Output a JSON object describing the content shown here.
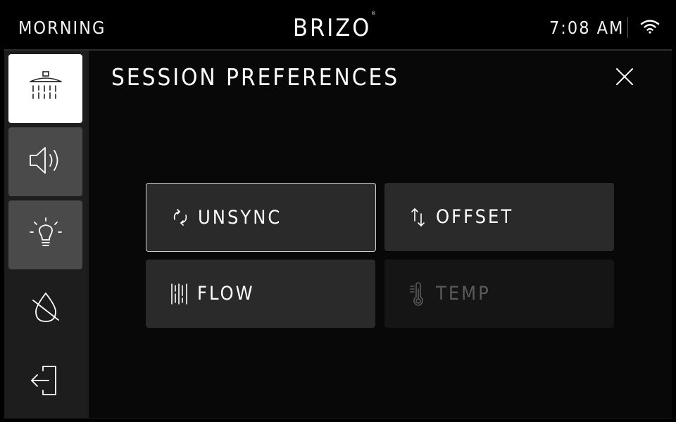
{
  "header": {
    "mode": "MORNING",
    "brand": "BRIZO",
    "time": "7:08 AM"
  },
  "sidebar": {
    "items": [
      {
        "icon": "shower-head-icon",
        "active": true
      },
      {
        "icon": "speaker-icon"
      },
      {
        "icon": "lightbulb-icon"
      },
      {
        "icon": "water-off-icon"
      },
      {
        "icon": "exit-icon"
      }
    ]
  },
  "main": {
    "title": "SESSION PREFERENCES",
    "options": [
      {
        "label": "UNSYNC",
        "icon": "sync-icon",
        "state": "selected"
      },
      {
        "label": "OFFSET",
        "icon": "offset-arrows-icon",
        "state": "normal"
      },
      {
        "label": "FLOW",
        "icon": "flow-bars-icon",
        "state": "normal"
      },
      {
        "label": "TEMP",
        "icon": "thermometer-icon",
        "state": "disabled"
      }
    ]
  },
  "colors": {
    "background": "#000000",
    "button": "#2a2a2a",
    "button_disabled": "#151515",
    "sidebar": "#1d1d1d",
    "sidebar_mid": "#4a4a4a",
    "active": "#ffffff",
    "disabled_text": "#5a5a5a"
  }
}
